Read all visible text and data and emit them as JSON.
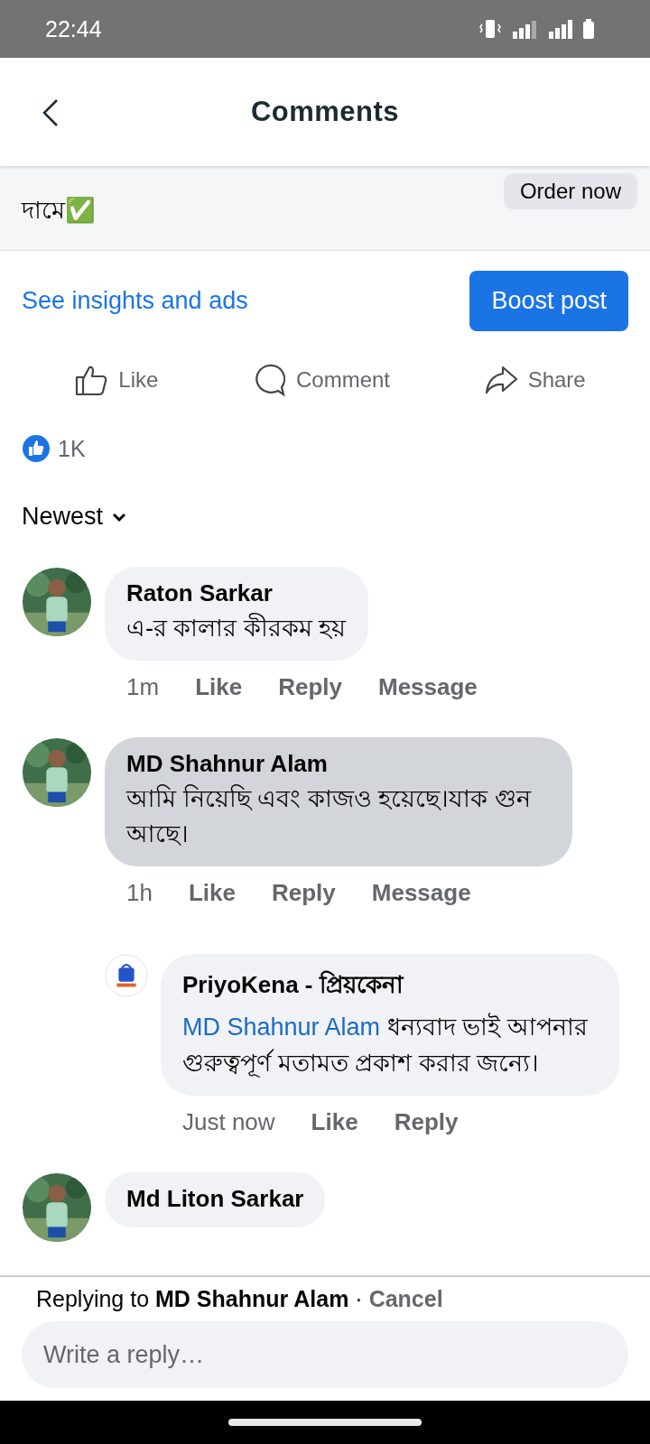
{
  "status_bar": {
    "time": "22:44"
  },
  "header": {
    "title": "Comments"
  },
  "post": {
    "text_fragment": "দামে✅",
    "order_button": "Order now"
  },
  "insights_link": "See insights and ads",
  "boost_button": "Boost post",
  "actions": [
    {
      "kind": "like",
      "label": "Like"
    },
    {
      "kind": "comment",
      "label": "Comment"
    },
    {
      "kind": "share",
      "label": "Share"
    }
  ],
  "reactions": {
    "count": "1K"
  },
  "sort": {
    "label": "Newest"
  },
  "comments": [
    {
      "author": "Raton Sarkar",
      "avatar": {
        "kind": "picture"
      },
      "text": "এ-র কালার কীরকম হয়",
      "time": "1m",
      "links": [
        "Like",
        "Reply",
        "Message"
      ],
      "highlighted": false
    },
    {
      "author": "MD Shahnur Alam",
      "avatar": {
        "kind": "picture"
      },
      "text": "আমি নিয়েছি এবং কাজও হয়েছে।যাক গুন আছে।",
      "time": "1h",
      "links": [
        "Like",
        "Reply",
        "Message"
      ],
      "highlighted": true,
      "replies": [
        {
          "author": "PriyoKena - প্রিয়কেনা",
          "avatar": {
            "kind": "logo"
          },
          "mention": "MD Shahnur Alam",
          "text": "ধন্যবাদ ভাই আপনার গুরুত্বপূর্ণ মতামত প্রকাশ করার জন্যে।",
          "time": "Just now",
          "links": [
            "Like",
            "Reply"
          ],
          "highlighted": false
        }
      ]
    },
    {
      "author": "Md Liton Sarkar",
      "avatar": {
        "kind": "picture"
      },
      "highlighted": false
    }
  ],
  "reply_bar": {
    "prefix": "Replying to",
    "name": "MD Shahnur Alam",
    "separator": "·",
    "cancel": "Cancel"
  },
  "composer": {
    "placeholder": "Write a reply…"
  }
}
